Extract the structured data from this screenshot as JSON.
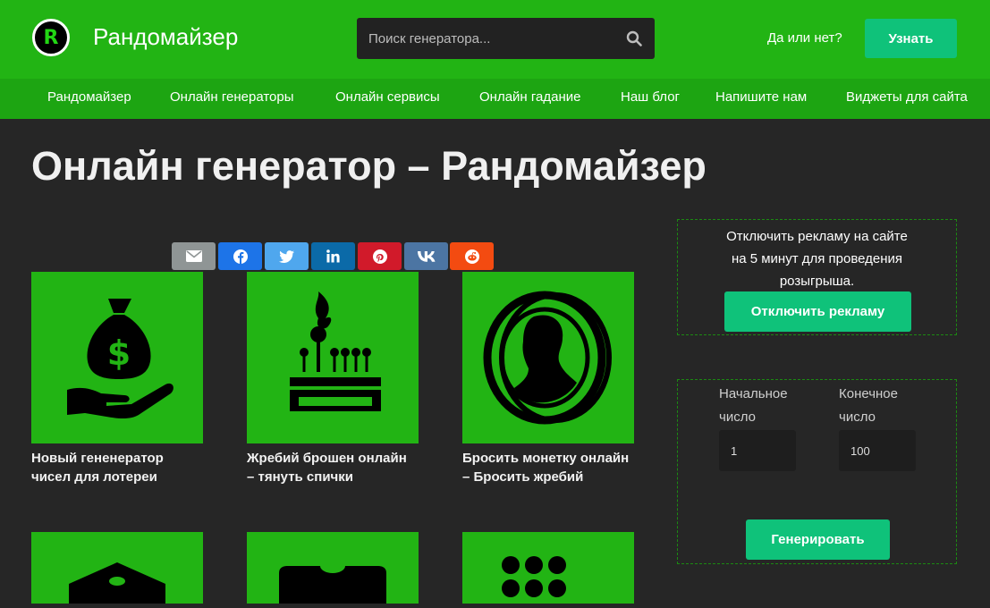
{
  "header": {
    "logo_letter": "R",
    "site_title": "Рандомайзер",
    "search_placeholder": "Поиск генератора...",
    "yes_no_label": "Да или нет?",
    "learn_button": "Узнать"
  },
  "nav": {
    "items": [
      "Рандомайзер",
      "Онлайн генераторы",
      "Онлайн сервисы",
      "Онлайн гадание",
      "Наш блог",
      "Напишите нам",
      "Виджеты для сайта"
    ]
  },
  "main": {
    "page_title": "Онлайн генератор – Рандомайзер",
    "share_buttons": [
      {
        "name": "email",
        "icon": "envelope-icon",
        "color": "#8f9595"
      },
      {
        "name": "facebook",
        "icon": "facebook-icon",
        "color": "#1d74e8"
      },
      {
        "name": "twitter",
        "icon": "twitter-icon",
        "color": "#4fa7ee"
      },
      {
        "name": "linkedin",
        "icon": "linkedin-icon",
        "color": "#0b6aa8"
      },
      {
        "name": "pinterest",
        "icon": "pinterest-icon",
        "color": "#d11a2a"
      },
      {
        "name": "vk",
        "icon": "vk-icon",
        "color": "#4c75a3"
      },
      {
        "name": "reddit",
        "icon": "reddit-icon",
        "color": "#f34b11"
      }
    ],
    "cards": [
      {
        "title_line1": "Новый гененератор",
        "title_line2": "чисел для лотереи",
        "icon": "money-bag-hand-icon"
      },
      {
        "title_line1": "Жребий брошен онлайн",
        "title_line2": "– тянуть спички",
        "icon": "matches-icon"
      },
      {
        "title_line1": "Бросить монетку онлайн",
        "title_line2": "– Бросить жребий",
        "icon": "coin-icon"
      },
      {
        "icon": "dice-icon"
      },
      {
        "icon": "ticket-icon"
      },
      {
        "icon": "dots-grid-icon"
      }
    ]
  },
  "sidebar": {
    "ad_text_line1": "Отключить рекламу на сайте",
    "ad_text_line2": "на 5 минут для проведения",
    "ad_text_line3": "розыгрыша.",
    "disable_ads_button": "Отключить рекламу",
    "start_label_line1": "Начальное",
    "start_label_line2": "число",
    "end_label_line1": "Конечное",
    "end_label_line2": "число",
    "start_value": "1",
    "end_value": "100",
    "generate_button": "Генерировать"
  },
  "colors": {
    "header_green": "#22b414",
    "nav_green": "#1da512",
    "accent_button": "#0fc27a",
    "background": "#262626"
  }
}
